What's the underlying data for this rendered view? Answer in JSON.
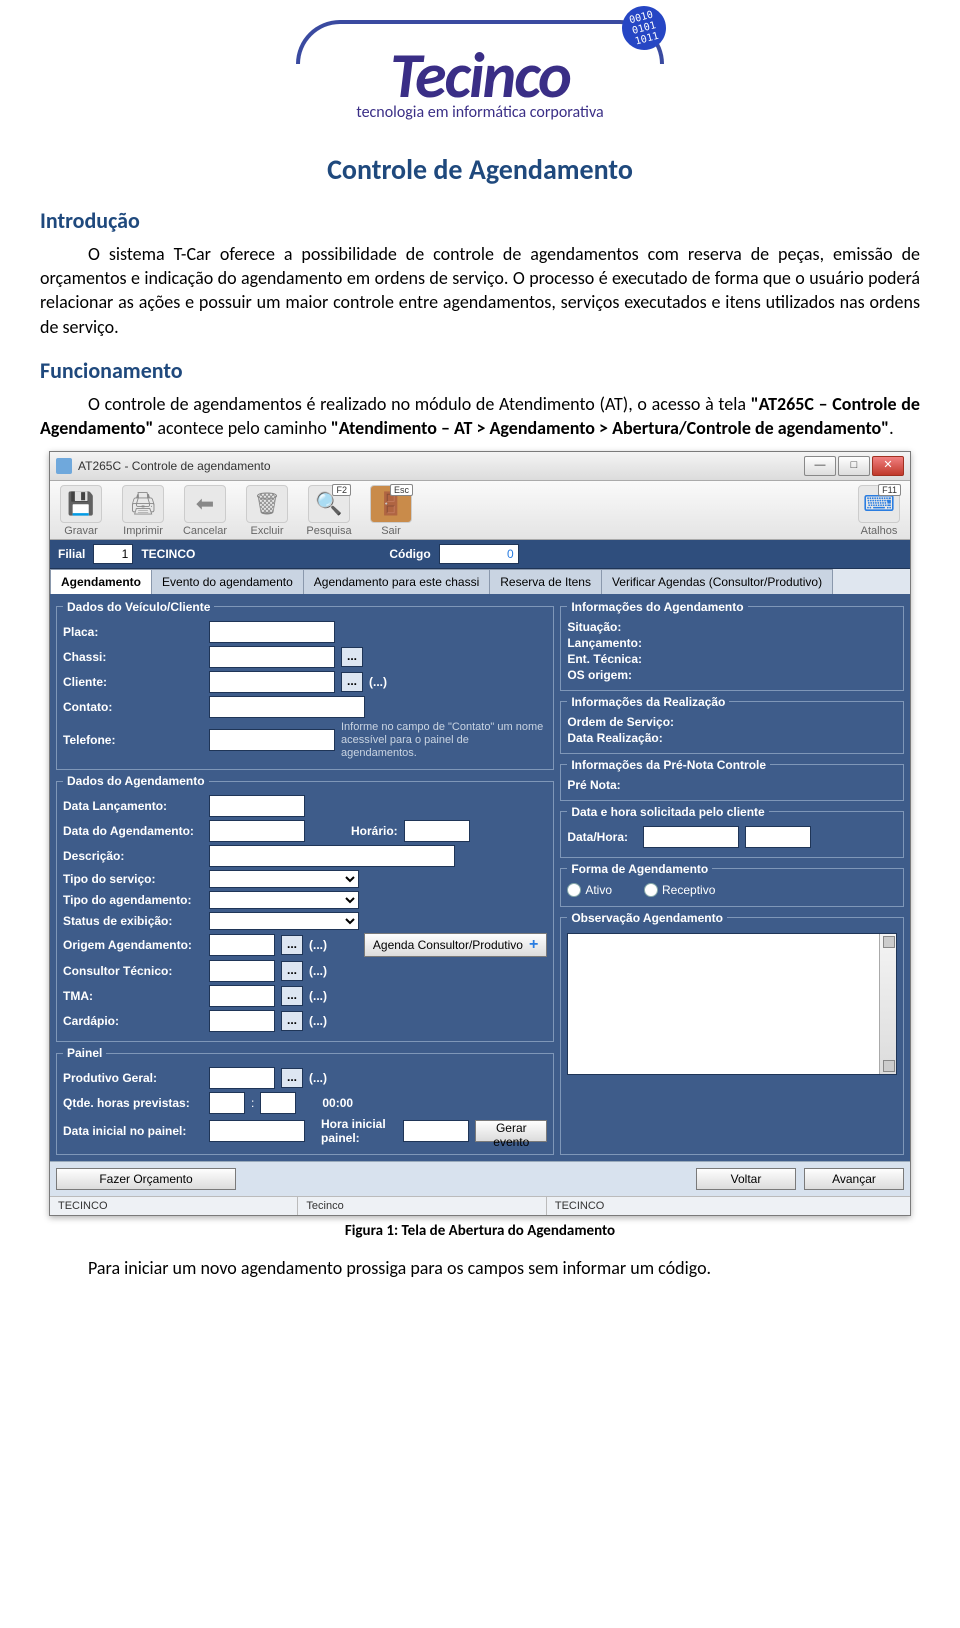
{
  "logo": {
    "chip": "0010\n0101\n1011",
    "brand": "Tecinco",
    "sub": "tecnologia em informática corporativa"
  },
  "title": "Controle de Agendamento",
  "sections": {
    "intro": {
      "heading": "Introdução",
      "p1": "O sistema T-Car oferece a possibilidade de controle de agendamentos com reserva de peças, emissão de orçamentos e indicação do agendamento em ordens de serviço. O processo é executado de forma que o usuário poderá relacionar as ações e possuir um maior controle entre agendamentos, serviços executados e itens utilizados nas ordens de serviço."
    },
    "func": {
      "heading": "Funcionamento",
      "p1_pre": "O controle de agendamentos é realizado no módulo de Atendimento (AT), o acesso à tela ",
      "p1_b1": "\"AT265C – Controle de Agendamento\"",
      "p1_mid": " acontece pelo caminho ",
      "p1_b2": "\"Atendimento – AT > Agendamento > Abertura/Controle de agendamento\"",
      "p1_end": "."
    }
  },
  "screenshot": {
    "window_title": "AT265C - Controle de agendamento",
    "toolbar": {
      "gravar": "Gravar",
      "imprimir": "Imprimir",
      "cancelar": "Cancelar",
      "excluir": "Excluir",
      "pesquisa": "Pesquisa",
      "pesquisa_key": "F2",
      "sair": "Sair",
      "sair_key": "Esc",
      "atalhos": "Atalhos",
      "atalhos_key": "F11"
    },
    "filial_bar": {
      "filial_label": "Filial",
      "filial_val": "1",
      "filial_name": "TECINCO",
      "codigo_label": "Código",
      "codigo_val": "0"
    },
    "tabs": [
      "Agendamento",
      "Evento do agendamento",
      "Agendamento para este chassi",
      "Reserva de Itens",
      "Verificar Agendas (Consultor/Produtivo)"
    ],
    "grp_veic": {
      "legend": "Dados do Veículo/Cliente",
      "placa": "Placa:",
      "chassi": "Chassi:",
      "cliente": "Cliente:",
      "contato": "Contato:",
      "telefone": "Telefone:",
      "hint": "Informe no campo de \"Contato\" um nome acessível para o painel de agendamentos.",
      "paren": "(...)"
    },
    "grp_agend": {
      "legend": "Dados do Agendamento",
      "data_lanc": "Data Lançamento:",
      "data_ag": "Data do Agendamento:",
      "horario": "Horário:",
      "descricao": "Descrição:",
      "tipo_serv": "Tipo do serviço:",
      "tipo_ag": "Tipo do agendamento:",
      "status": "Status de exibição:",
      "origem": "Origem Agendamento:",
      "consultor": "Consultor Técnico:",
      "tma": "TMA:",
      "cardapio": "Cardápio:",
      "btn_agenda": "Agenda Consultor/Produtivo",
      "paren": "(...)"
    },
    "grp_painel": {
      "legend": "Painel",
      "prod_geral": "Produtivo Geral:",
      "qtde": "Qtde. horas previstas:",
      "qtde_sep": ":",
      "qtde_val": "00:00",
      "data_ini": "Data inicial no painel:",
      "hora_ini": "Hora inicial painel:",
      "gerar": "Gerar evento",
      "paren": "(...)"
    },
    "grp_info_ag": {
      "legend": "Informações do Agendamento",
      "situacao": "Situação:",
      "lancamento": "Lançamento:",
      "ent_tec": "Ent. Técnica:",
      "os_origem": "OS origem:"
    },
    "grp_info_real": {
      "legend": "Informações da Realização",
      "os": "Ordem de Serviço:",
      "data_real": "Data Realização:"
    },
    "grp_prenota": {
      "legend": "Informações da Pré-Nota Controle",
      "prenota": "Pré Nota:"
    },
    "grp_cliente_dh": {
      "legend": "Data e hora solicitada pelo cliente",
      "datahora": "Data/Hora:"
    },
    "grp_forma": {
      "legend": "Forma de Agendamento",
      "ativo": "Ativo",
      "receptivo": "Receptivo"
    },
    "grp_obs": {
      "legend": "Observação Agendamento"
    },
    "footer": {
      "orc": "Fazer Orçamento",
      "voltar": "Voltar",
      "avancar": "Avançar"
    },
    "statusbar": {
      "c1": "TECINCO",
      "c2": "Tecinco",
      "c3": "TECINCO"
    }
  },
  "caption": "Figura 1: Tela de Abertura do Agendamento",
  "closing": "Para iniciar um novo agendamento prossiga para os campos sem informar um código."
}
